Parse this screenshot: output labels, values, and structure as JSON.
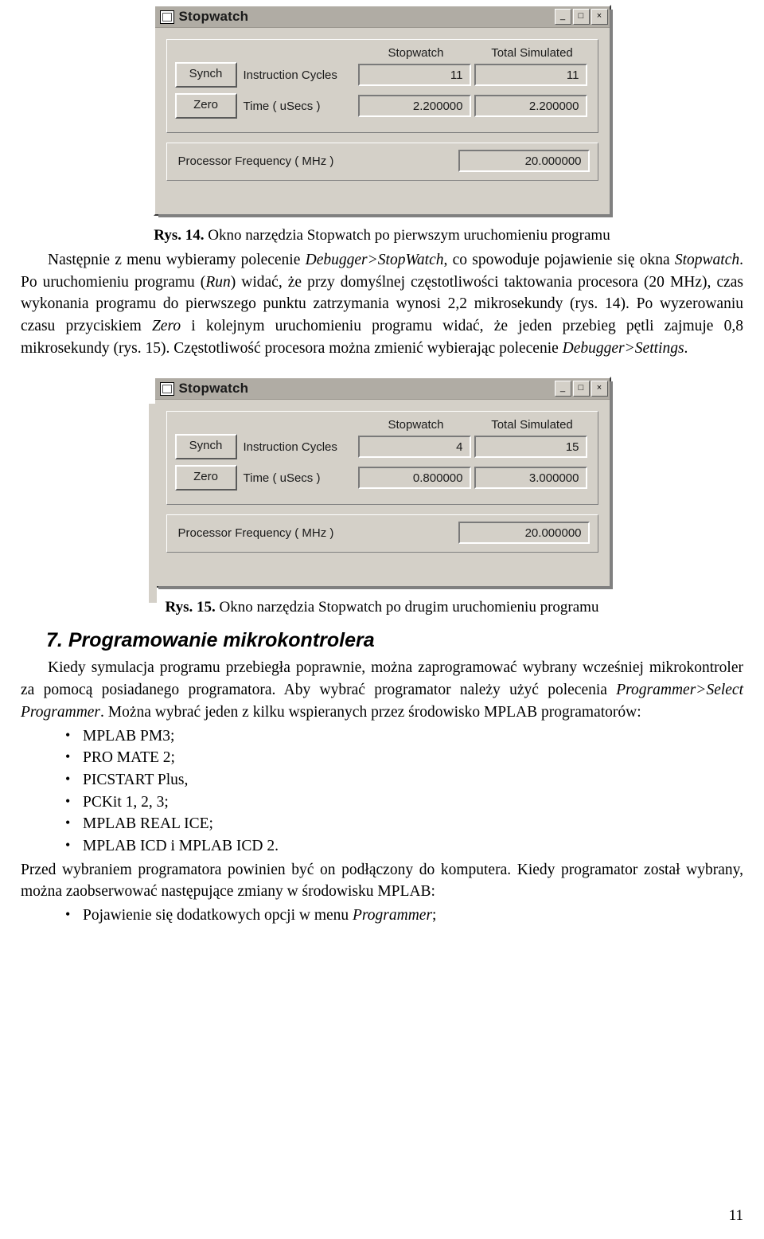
{
  "window1": {
    "title": "Stopwatch",
    "icon": "stopwatch-window-icon",
    "buttons": {
      "minimize": "_",
      "maximize": "□",
      "close": "×"
    },
    "columns": {
      "col1": "Stopwatch",
      "col2": "Total Simulated"
    },
    "rows": [
      {
        "button": "Synch",
        "label": "Instruction  Cycles",
        "stopwatch": "11",
        "total": "11"
      },
      {
        "button": "Zero",
        "label": "Time   ( uSecs )",
        "stopwatch": "2.200000",
        "total": "2.200000"
      }
    ],
    "frequency": {
      "label": "Processor Frequency     ( MHz )",
      "value": "20.000000"
    }
  },
  "caption1": {
    "prefix": "Rys. 14.",
    "text": " Okno narzędzia Stopwatch po pierwszym uruchomieniu programu"
  },
  "para1": {
    "t1": "Następnie z menu wybieramy polecenie ",
    "i1": "Debugger>StopWatch",
    "t2": ", co spowoduje pojawienie się okna ",
    "i2": "Stopwatch",
    "t3": ". Po uruchomieniu programu (",
    "i3": "Run",
    "t4": ") widać, że przy domyślnej częstotliwości taktowania procesora (20 MHz), czas wykonania programu do pierwszego punktu zatrzymania wynosi 2,2 mikrosekundy (rys. 14). Po wyzerowaniu czasu przyciskiem ",
    "i4": "Zero",
    "t5": " i kolejnym uruchomieniu programu widać, że jeden przebieg pętli zajmuje 0,8 mikrosekundy (rys. 15). Częstotliwość procesora można zmienić wybierając polecenie ",
    "i5": "Debugger>Settings",
    "t6": "."
  },
  "window2": {
    "title": "Stopwatch",
    "icon": "stopwatch-window-icon",
    "buttons": {
      "minimize": "_",
      "maximize": "□",
      "close": "×"
    },
    "columns": {
      "col1": "Stopwatch",
      "col2": "Total Simulated"
    },
    "rows": [
      {
        "button": "Synch",
        "label": "Instruction  Cycles",
        "stopwatch": "4",
        "total": "15"
      },
      {
        "button": "Zero",
        "label": "Time   ( uSecs )",
        "stopwatch": "0.800000",
        "total": "3.000000"
      }
    ],
    "frequency": {
      "label": "Processor Frequency     ( MHz )",
      "value": "20.000000"
    }
  },
  "caption2": {
    "prefix": "Rys. 15.",
    "text": " Okno narzędzia Stopwatch po drugim uruchomieniu programu"
  },
  "section7": {
    "number": "7.",
    "title": "Programowanie mikrokontrolera"
  },
  "para2": {
    "t1": "Kiedy symulacja programu przebiegła poprawnie, można zaprogramować wybrany wcześniej mikrokontroler za pomocą posiadanego programatora. Aby wybrać programator należy użyć polecenia ",
    "i1": "Programmer>Select Programmer",
    "t2": ". Można wybrać jeden z kilku wspieranych przez środowisko MPLAB programatorów:"
  },
  "programmers": [
    "MPLAB PM3;",
    "PRO MATE 2;",
    "PICSTART Plus,",
    "PCKit 1, 2, 3;",
    "MPLAB REAL ICE;",
    "MPLAB ICD i MPLAB ICD 2."
  ],
  "para3": {
    "t1": "Przed wybraniem programatora powinien być on podłączony do komputera. Kiedy programator został wybrany, można zaobserwować następujące zmiany w środowisku MPLAB:"
  },
  "bullet_last": {
    "t1": "Pojawienie się dodatkowych opcji w menu ",
    "i1": "Programmer",
    "t2": ";"
  },
  "page_number": "11"
}
